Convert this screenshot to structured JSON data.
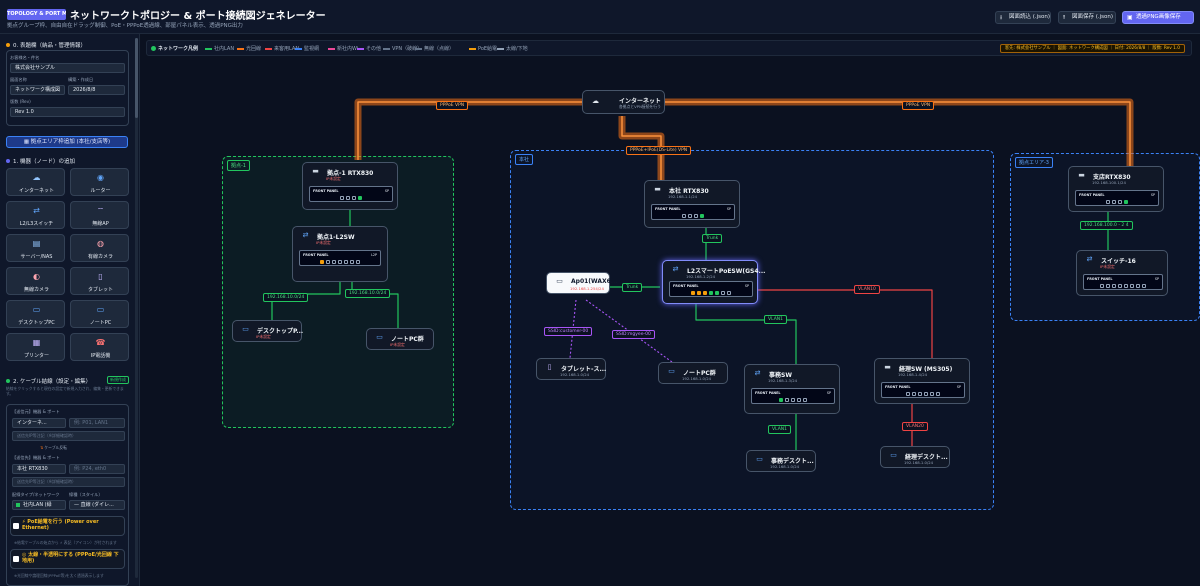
{
  "header": {
    "badge": "TOPOLOGY & PORT MAP",
    "title": "ネットワークトポロジー & ポート接続図ジェネレーター",
    "subtitle": "拠点グループ枠、自由自在ドラッグ制御、PoE・PPPoE透過線、部屋パネル表示、透過PNG出力",
    "btn_load": "図面読込 (.json)",
    "btn_save": "図面保存 (.json)",
    "btn_png": "透過PNG画像保存"
  },
  "sidebar": {
    "sec0": "0. 表題欄（納品・管理情報）",
    "f_customer_lbl": "お客様名・件名",
    "f_customer": "株式会社サンプル",
    "f_drawing_lbl": "図面名称",
    "f_drawing": "ネットワーク構成図",
    "f_date_lbl": "構築・作成日",
    "f_date": "2026/8/8",
    "f_rev_lbl": "版数 (Rev)",
    "f_rev": "Rev 1.0",
    "add_area": "拠点エリア枠追加 (本社/支店等)",
    "sec1": "1. 機器（ノード）の追加",
    "devices": [
      {
        "icon": "☁",
        "label": "インターネット"
      },
      {
        "icon": "◉",
        "label": "ルーター"
      },
      {
        "icon": "⇄",
        "label": "L2/L3スイッチ"
      },
      {
        "icon": "⌔",
        "label": "無線AP"
      },
      {
        "icon": "▤",
        "label": "サーバー/NAS"
      },
      {
        "icon": "◍",
        "label": "有線カメラ"
      },
      {
        "icon": "◐",
        "label": "無線カメラ"
      },
      {
        "icon": "▯",
        "label": "タブレット"
      },
      {
        "icon": "▭",
        "label": "デスクトップPC"
      },
      {
        "icon": "▭",
        "label": "ノートPC"
      },
      {
        "icon": "▦",
        "label": "プリンター"
      },
      {
        "icon": "☎",
        "label": "IP電話機"
      }
    ],
    "sec2": "2. ケーブル結線（設定・編集）",
    "sec2_badge": "新規作成",
    "sec2_help": "結線をクリックすると現在の設定で新規入力され、編集・更新できます。",
    "src_lbl": "【送信元】機器 & ポート",
    "src_dev": "インターネ...",
    "src_port_ph": "例: P01, LAN1",
    "src_note_ph": "送信先IP等注記（※詳細確認時）",
    "swap": "ケーブル反転",
    "dst_lbl": "【送信先】機器 & ポート",
    "dst_dev": "本社 RTX830",
    "dst_port_ph": "例: P24, eth0",
    "dst_note_ph": "送信先IP等注記（※詳細確認時）",
    "net_lbl": "配線タイプ/ネットワーク",
    "style_lbl": "線種（スタイル）",
    "net_val": "社内LAN (緑",
    "style_val": "— 直線 (ダイレ...",
    "poe_lbl": "PoE給電を行う (Power over Ethernet)",
    "poe_note": "※給電ケーブルの始点から ⚡ 表記（アイコン）が付されます",
    "thick_lbl": "太線・半透明にする (PPPoE/光回線 下地用)",
    "thick_note": "※光回線や論理回線(PPPoE等)を太く透過表示します"
  },
  "legend": {
    "title": "ネットワーク凡例",
    "items": [
      {
        "label": "社内LAN",
        "color": "#22c55e"
      },
      {
        "label": "光回線",
        "color": "#f97316"
      },
      {
        "label": "来客用LAN",
        "color": "#ef4444"
      },
      {
        "label": "監視網",
        "color": "#3b82f6"
      },
      {
        "label": "新社内Wi",
        "color": "#ec4899"
      },
      {
        "label": "その他",
        "color": "#a855f7"
      },
      {
        "label": "VPN（破線）",
        "color": "#64748b"
      },
      {
        "label": "無線（点線）",
        "color": "#64748b"
      },
      {
        "label": "PoE給電",
        "color": "#f59e0b"
      },
      {
        "label": "太線/下地",
        "color": "#94a3b8"
      }
    ],
    "meta": "客先: 株式会社サンプル ｜ 図面: ネットワーク構成図 ｜ 日付: 2026/8/8 ｜ 版数: Rev 1.0"
  },
  "areas": {
    "a1": "拠点-1",
    "a2": "本社",
    "a3": "拠点エリア-3"
  },
  "nodes": {
    "inet": {
      "title": "インターネット",
      "sub": "各拠点とVPN接続を行う"
    },
    "rtx1": {
      "title": "拠点-1 RTX830",
      "sub": "IP未設定"
    },
    "l2sw1": {
      "title": "拠点1-L2SW",
      "sub": "IP未設定"
    },
    "dpc1": {
      "title": "デスクトップP...",
      "sub": "IP未設定"
    },
    "npc1": {
      "title": "ノートPC群",
      "sub": "IP未設定"
    },
    "hqrtx": {
      "title": "本社 RTX830",
      "sub": "192.168.1.1/24"
    },
    "poesw": {
      "title": "L2スマートPoESW(GS4...",
      "sub": "192.168.1.2/24"
    },
    "ap": {
      "title": "Ap01(WAX6...",
      "sub": "192.168.1.254/24"
    },
    "tab": {
      "title": "タブレット-ス...",
      "sub": "192.168.1.0/24"
    },
    "npc2": {
      "title": "ノートPC群",
      "sub": "192.168.1.0/24"
    },
    "jsw": {
      "title": "事務SW",
      "sub": "192.168.1.3/24"
    },
    "ksw": {
      "title": "経理SW (MS305)",
      "sub": "192.168.1.4/24"
    },
    "jdpc": {
      "title": "事務デスクト...",
      "sub": "192.168.1.0/24"
    },
    "kdpc": {
      "title": "経理デスクト...",
      "sub": "192.168.1.0/24"
    },
    "shrtx": {
      "title": "支店RTX830",
      "sub": "192.168.100.1/24"
    },
    "sw16": {
      "title": "スイッチ-16",
      "sub": "IP未設定"
    }
  },
  "panel": {
    "front": "FRONT PANEL",
    "sp": "SP",
    "l2p": "L2P"
  },
  "edges": {
    "pppoe_l": "PPPoE VPN",
    "pppoe_r": "PPPoE VPN",
    "pppoe_c": "PPPoE+IPoE(DS-Lite) VPN",
    "trunk1": "Trunk",
    "trunk2": "Trunk",
    "subnet1": "192.168.10.0/24",
    "subnet2": "192.168.10.0/24",
    "subnet3": "192.168.100.0 - 2 4",
    "vlan10": "VLAN10",
    "vlan1a": "VLAN1",
    "vlan1b": "VLAN1",
    "vlan20": "VLAN20",
    "ssid1": "SSID:customer-00",
    "ssid2": "SSID:mgyee-00"
  }
}
